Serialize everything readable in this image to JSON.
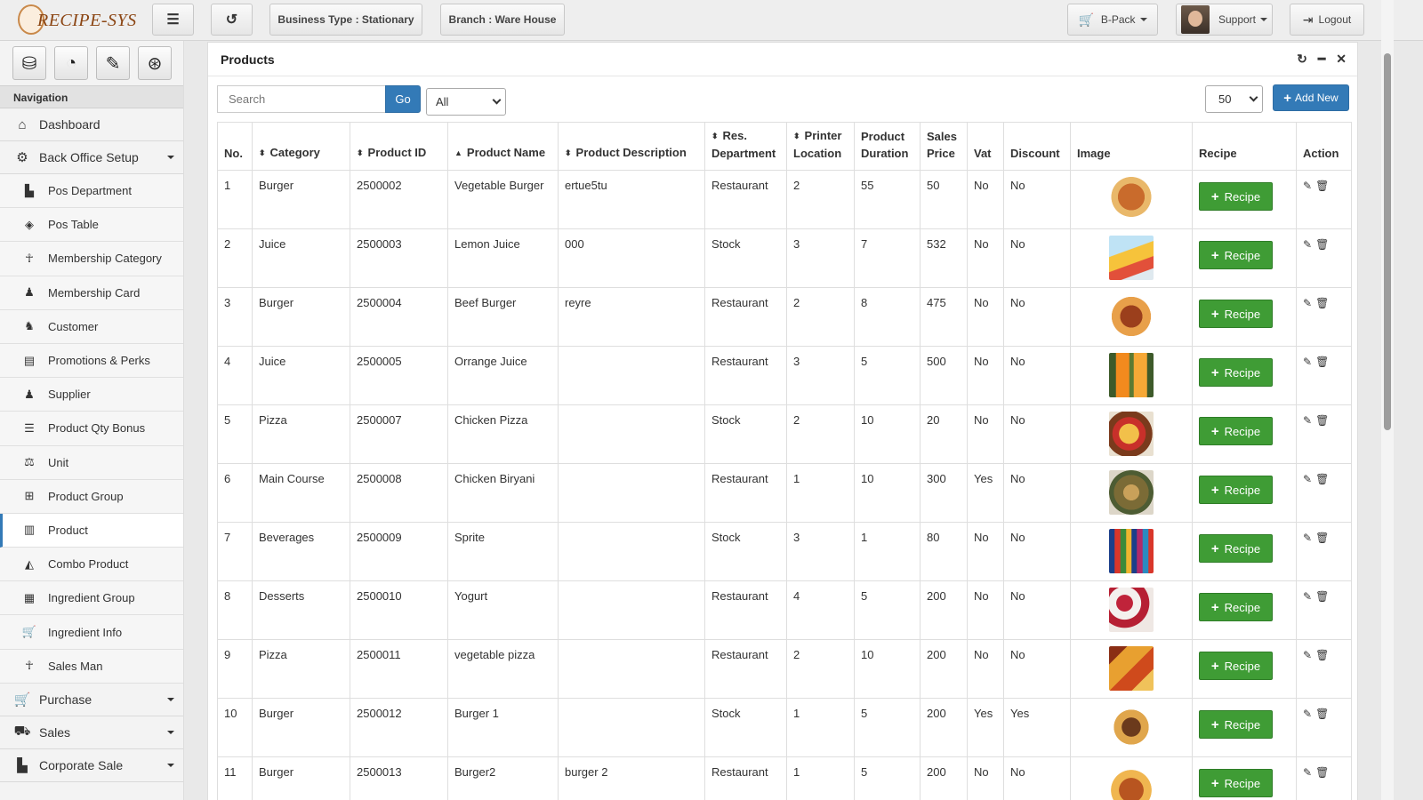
{
  "header": {
    "logo_text": "RECIPE-SYS",
    "business_type": "Business Type : Stationary",
    "branch": "Branch : Ware House",
    "cart_label": "B-Pack",
    "support_label": "Support",
    "logout_label": "Logout"
  },
  "sidebar": {
    "nav_heading": "Navigation",
    "top_items": [
      {
        "label": "Dashboard"
      },
      {
        "label": "Back Office Setup"
      },
      {
        "label": "Purchase"
      },
      {
        "label": "Sales"
      },
      {
        "label": "Corporate Sale"
      }
    ],
    "sub_items": [
      {
        "label": "Pos Department"
      },
      {
        "label": "Pos Table"
      },
      {
        "label": "Membership Category"
      },
      {
        "label": "Membership Card"
      },
      {
        "label": "Customer"
      },
      {
        "label": "Promotions & Perks"
      },
      {
        "label": "Supplier"
      },
      {
        "label": "Product Qty Bonus"
      },
      {
        "label": "Unit"
      },
      {
        "label": "Product Group"
      },
      {
        "label": "Product"
      },
      {
        "label": "Combo Product"
      },
      {
        "label": "Ingredient Group"
      },
      {
        "label": "Ingredient Info"
      },
      {
        "label": "Sales Man"
      }
    ],
    "active_item": "Product"
  },
  "panel": {
    "title": "Products",
    "search_placeholder": "Search",
    "go_label": "Go",
    "filter_value": "All",
    "page_size": "50",
    "add_new_label": "Add New"
  },
  "table": {
    "columns": [
      "No.",
      "Category",
      "Product ID",
      "Product Name",
      "Product Description",
      "Res. Department",
      "Printer Location",
      "Product Duration",
      "Sales Price",
      "Vat",
      "Discount",
      "Image",
      "Recipe",
      "Action"
    ],
    "recipe_label": "Recipe",
    "rows": [
      {
        "no": "1",
        "category": "Burger",
        "product_id": "2500002",
        "name": "Vegetable Burger",
        "description": "ertue5tu",
        "department": "Restaurant",
        "printer": "2",
        "duration": "55",
        "price": "50",
        "vat": "No",
        "discount": "No"
      },
      {
        "no": "2",
        "category": "Juice",
        "product_id": "2500003",
        "name": "Lemon Juice",
        "description": "000",
        "department": "Stock",
        "printer": "3",
        "duration": "7",
        "price": "532",
        "vat": "No",
        "discount": "No"
      },
      {
        "no": "3",
        "category": "Burger",
        "product_id": "2500004",
        "name": "Beef Burger",
        "description": "reyre",
        "department": "Restaurant",
        "printer": "2",
        "duration": "8",
        "price": "475",
        "vat": "No",
        "discount": "No"
      },
      {
        "no": "4",
        "category": "Juice",
        "product_id": "2500005",
        "name": "Orrange Juice",
        "description": "",
        "department": "Restaurant",
        "printer": "3",
        "duration": "5",
        "price": "500",
        "vat": "No",
        "discount": "No"
      },
      {
        "no": "5",
        "category": "Pizza",
        "product_id": "2500007",
        "name": "Chicken Pizza",
        "description": "",
        "department": "Stock",
        "printer": "2",
        "duration": "10",
        "price": "20",
        "vat": "No",
        "discount": "No"
      },
      {
        "no": "6",
        "category": "Main Course",
        "product_id": "2500008",
        "name": "Chicken Biryani",
        "description": "",
        "department": "Restaurant",
        "printer": "1",
        "duration": "10",
        "price": "300",
        "vat": "Yes",
        "discount": "No"
      },
      {
        "no": "7",
        "category": "Beverages",
        "product_id": "2500009",
        "name": "Sprite",
        "description": "",
        "department": "Stock",
        "printer": "3",
        "duration": "1",
        "price": "80",
        "vat": "No",
        "discount": "No"
      },
      {
        "no": "8",
        "category": "Desserts",
        "product_id": "2500010",
        "name": "Yogurt",
        "description": "",
        "department": "Restaurant",
        "printer": "4",
        "duration": "5",
        "price": "200",
        "vat": "No",
        "discount": "No"
      },
      {
        "no": "9",
        "category": "Pizza",
        "product_id": "2500011",
        "name": "vegetable pizza",
        "description": "",
        "department": "Restaurant",
        "printer": "2",
        "duration": "10",
        "price": "200",
        "vat": "No",
        "discount": "No"
      },
      {
        "no": "10",
        "category": "Burger",
        "product_id": "2500012",
        "name": "Burger 1",
        "description": "",
        "department": "Stock",
        "printer": "1",
        "duration": "5",
        "price": "200",
        "vat": "Yes",
        "discount": "Yes"
      },
      {
        "no": "11",
        "category": "Burger",
        "product_id": "2500013",
        "name": "Burger2",
        "description": "burger 2",
        "department": "Restaurant",
        "printer": "1",
        "duration": "5",
        "price": "200",
        "vat": "No",
        "discount": "No"
      }
    ]
  },
  "colors": {
    "primary": "#337ab7",
    "recipe_green": "#3f9c35"
  }
}
